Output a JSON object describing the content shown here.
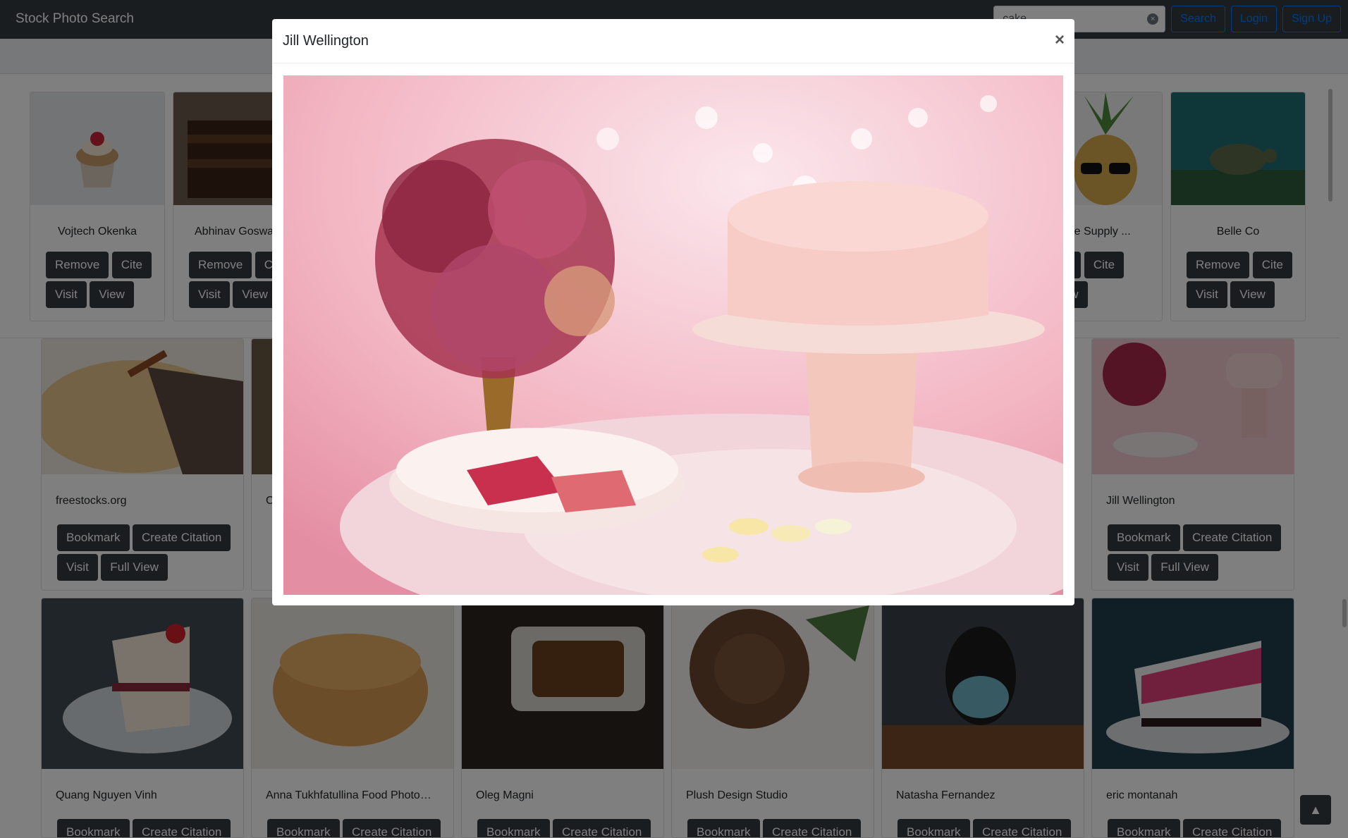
{
  "navbar": {
    "brand": "Stock Photo Search",
    "search_value": "cake",
    "search_button": "Search",
    "login_button": "Login",
    "signup_button": "Sign Up",
    "clear_glyph": "×"
  },
  "bookmarks": [
    {
      "name": "Vojtech Okenka",
      "remove": "Remove",
      "cite": "Cite",
      "visit": "Visit",
      "view": "View"
    },
    {
      "name": "Abhinav Goswa",
      "remove": "Remove",
      "cite": "Ci",
      "visit": "Visit",
      "view": "View"
    },
    {
      "name": "ople Supply ...",
      "remove": "ove",
      "cite": "Cite",
      "visit": "",
      "view": "View"
    },
    {
      "name": "Belle Co",
      "remove": "Remove",
      "cite": "Cite",
      "visit": "Visit",
      "view": "View"
    }
  ],
  "results_row1": [
    {
      "name": "freestocks.org",
      "bookmark": "Bookmark",
      "cite": "Create Citation",
      "visit": "Visit",
      "full": "Full View"
    },
    {
      "name": "C",
      "bookmark": "",
      "cite": "",
      "visit": "",
      "full": ""
    },
    {
      "name": "Jill Wellington",
      "bookmark": "Bookmark",
      "cite": "Create Citation",
      "visit": "Visit",
      "full": "Full View"
    }
  ],
  "results_row2": [
    {
      "name": "Quang Nguyen Vinh",
      "bookmark": "Bookmark",
      "cite": "Create Citation"
    },
    {
      "name": "Anna Tukhfatullina Food Photog...",
      "bookmark": "Bookmark",
      "cite": "Create Citation"
    },
    {
      "name": "Oleg Magni",
      "bookmark": "Bookmark",
      "cite": "Create Citation"
    },
    {
      "name": "Plush Design Studio",
      "bookmark": "Bookmark",
      "cite": "Create Citation"
    },
    {
      "name": "Natasha Fernandez",
      "bookmark": "Bookmark",
      "cite": "Create Citation"
    },
    {
      "name": "eric montanah",
      "bookmark": "Bookmark",
      "cite": "Create Citation"
    }
  ],
  "modal": {
    "title": "Jill Wellington",
    "close_glyph": "×"
  },
  "scroll_top_glyph": "▲"
}
